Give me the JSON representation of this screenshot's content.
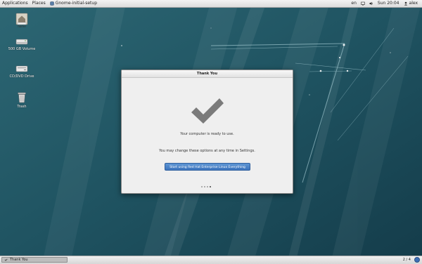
{
  "top_panel": {
    "applications": "Applications",
    "places": "Places",
    "active_app": "Gnome-initial-setup",
    "keyboard_layout": "en",
    "clock": "Sun 20:04",
    "user": "alex"
  },
  "desktop_icons": {
    "home_chip": "home",
    "volume": "500 GB Volume",
    "cdrom": "CD/DVD Drive",
    "trash": "Trash"
  },
  "dialog": {
    "title": "Thank You",
    "message_ready": "Your computer is ready to use.",
    "message_change": "You may change these options at any time in Settings.",
    "start_button": "Start using Red Hat Enterprise Linux Everything",
    "page_count": 4,
    "active_page": 4
  },
  "bottom_panel": {
    "task_title": "Thank You",
    "workspace": "2 / 4"
  },
  "colors": {
    "desktop": "#1f5663",
    "button": "#4a86cc",
    "check": "#7b7b7b"
  }
}
